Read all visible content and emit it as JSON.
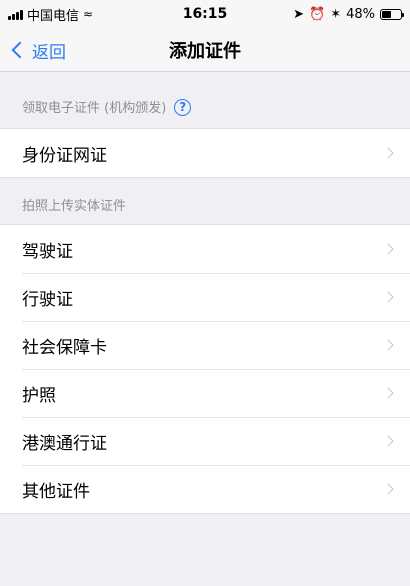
{
  "status_bar": {
    "carrier": "中国电信",
    "time": "16:15",
    "battery_percent": "48%",
    "battery_level": 0.48,
    "icons": [
      "signal-icon",
      "wifi-icon",
      "location-icon",
      "alarm-icon",
      "bluetooth-icon",
      "battery-icon"
    ]
  },
  "nav": {
    "back_label": "返回",
    "title": "添加证件"
  },
  "sections": [
    {
      "header": "领取电子证件 (机构颁发)",
      "has_help_icon": true,
      "items": [
        {
          "label": "身份证网证"
        }
      ]
    },
    {
      "header": "拍照上传实体证件",
      "has_help_icon": false,
      "items": [
        {
          "label": "驾驶证"
        },
        {
          "label": "行驶证"
        },
        {
          "label": "社会保障卡"
        },
        {
          "label": "护照"
        },
        {
          "label": "港澳通行证"
        },
        {
          "label": "其他证件"
        }
      ]
    }
  ],
  "colors": {
    "accent": "#2f7bf5",
    "background": "#efeff4",
    "secondary_text": "#8e8e93"
  }
}
